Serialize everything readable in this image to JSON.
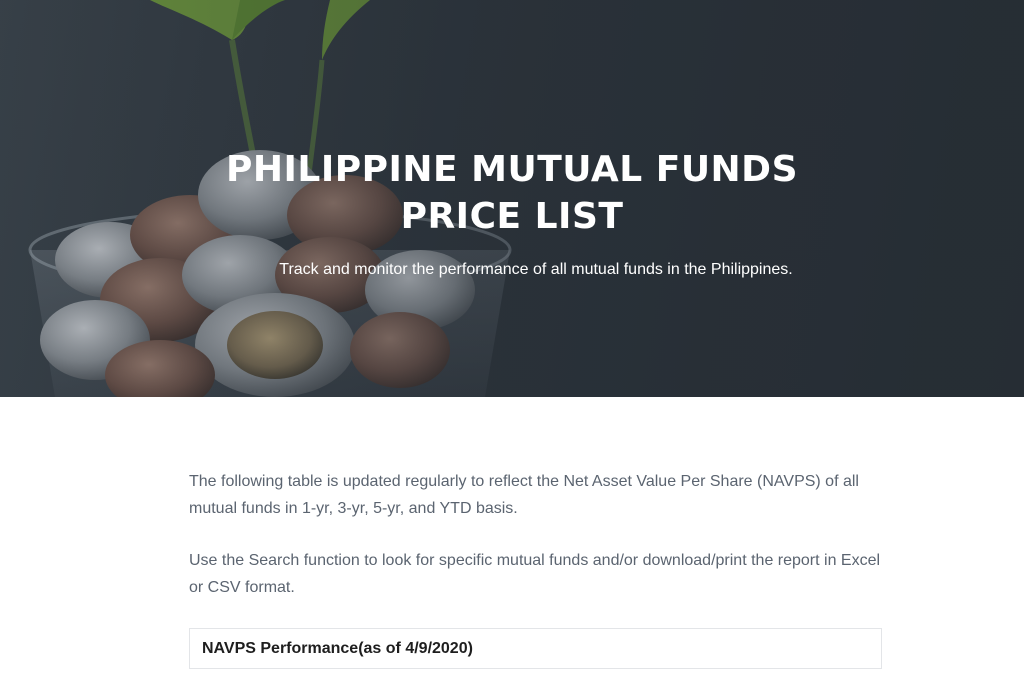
{
  "hero": {
    "title_line1": "PHILIPPINE MUTUAL FUNDS",
    "title_line2": "PRICE LIST",
    "subtitle": "Track and monitor the performance of all mutual funds in the Philippines."
  },
  "intro": {
    "paragraph1": "The following table is updated regularly to reflect the Net Asset Value Per Share (NAVPS) of all mutual funds in 1-yr, 3-yr, 5-yr, and YTD basis.",
    "paragraph2": "Use the Search function to look for specific mutual funds and/or download/print the report in Excel or CSV format."
  },
  "table": {
    "title": "NAVPS Performance(as of 4/9/2020)"
  }
}
